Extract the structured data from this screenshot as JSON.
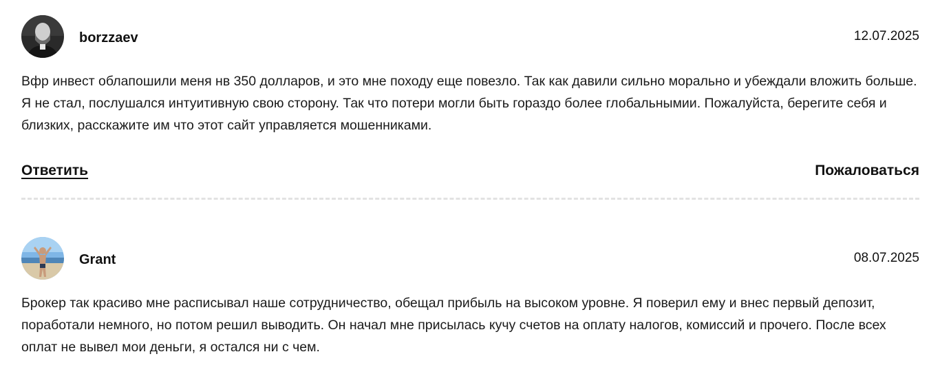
{
  "comments": [
    {
      "author": "borzzaev",
      "date": "12.07.2025",
      "text": "Вфр инвест облапошили меня нв 350 долларов, и это мне походу еще повезло. Так как давили сильно морально и убеждали вложить больше. Я не стал, послушался интуитивную свою сторону. Так что потери могли быть гораздо более глобальнымии. Пожалуйста, берегите себя и близких, расскажите им что этот сайт управляется мошенниками.",
      "reply_label": "Ответить",
      "report_label": "Пожаловаться"
    },
    {
      "author": "Grant",
      "date": "08.07.2025",
      "text": "Брокер так красиво мне расписывал наше сотрудничество, обещал прибыль на высоком уровне. Я поверил ему и внес первый депозит, поработали немного, но потом решил выводить. Он начал мне присылась кучу счетов на оплату налогов, комиссий и прочего. После всех оплат не вывел мои деньги, я остался ни с чем."
    }
  ]
}
